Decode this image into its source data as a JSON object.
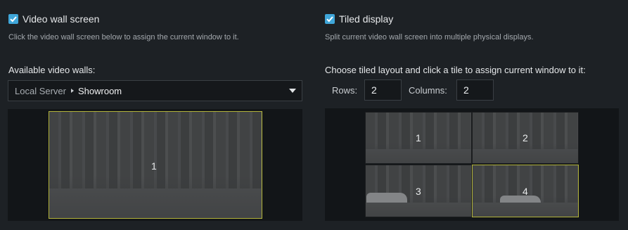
{
  "left": {
    "checkbox_label": "Video wall screen",
    "checked": true,
    "description": "Click the video wall screen below to assign the current window to it.",
    "available_label": "Available video walls:",
    "dropdown": {
      "server": "Local Server",
      "wall": "Showroom"
    },
    "screen": {
      "label": "1",
      "selected": true
    }
  },
  "right": {
    "checkbox_label": "Tiled display",
    "checked": true,
    "description": "Split current video wall screen into multiple physical displays.",
    "layout_label": "Choose tiled layout and click a tile to assign current window to it:",
    "rows_label": "Rows:",
    "rows_value": "2",
    "columns_label": "Columns:",
    "columns_value": "2",
    "tiles": [
      {
        "label": "1",
        "selected": false
      },
      {
        "label": "2",
        "selected": false
      },
      {
        "label": "3",
        "selected": false
      },
      {
        "label": "4",
        "selected": true
      }
    ]
  },
  "colors": {
    "accent": "#3fa6d9",
    "selection": "#b2b33a",
    "background": "#1d2125"
  },
  "icons": [
    "checkmark-icon",
    "chevron-right-icon",
    "dropdown-caret-icon"
  ]
}
